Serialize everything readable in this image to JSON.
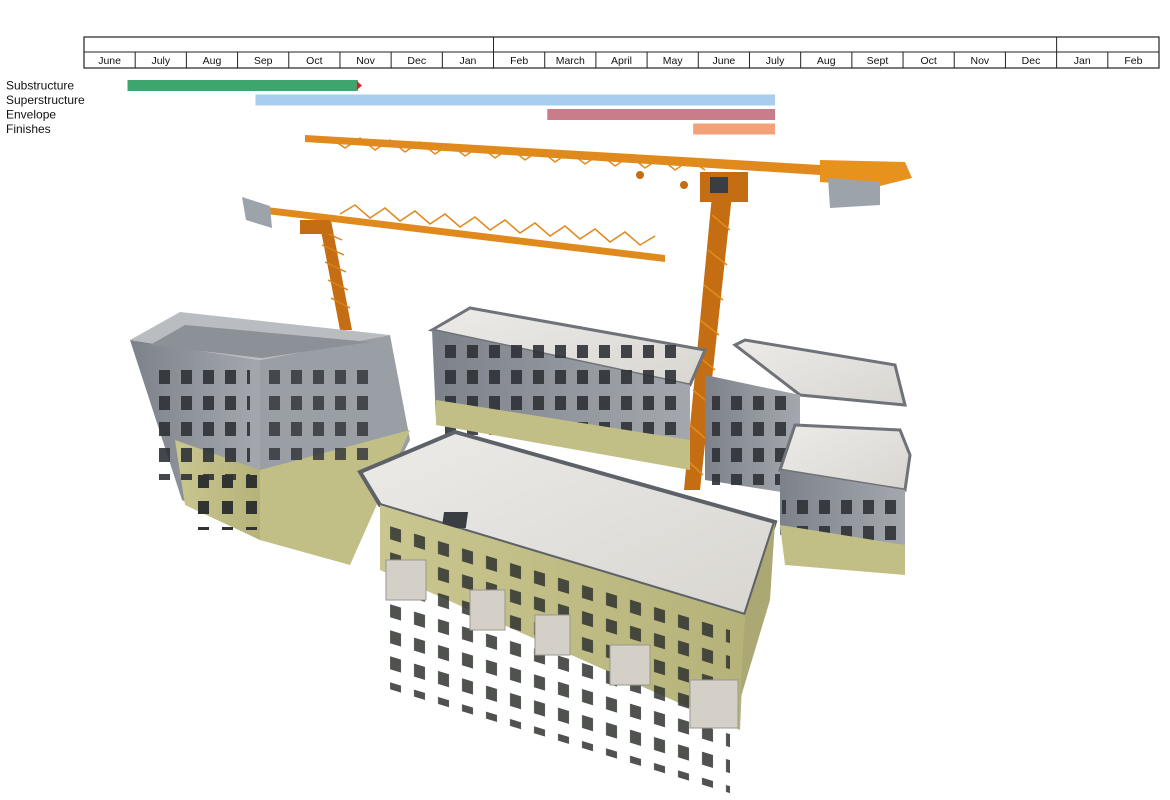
{
  "chart_data": {
    "type": "gantt",
    "title": "",
    "months": [
      "June",
      "July",
      "Aug",
      "Sep",
      "Oct",
      "Nov",
      "Dec",
      "Jan",
      "Feb",
      "March",
      "April",
      "May",
      "June",
      "July",
      "Aug",
      "Sept",
      "Oct",
      "Nov",
      "Dec",
      "Jan",
      "Feb"
    ],
    "year_breaks_before_index": [
      8,
      19
    ],
    "tasks": [
      {
        "name": "Substructure",
        "start": 0.85,
        "end": 5.35,
        "color": "#3ea56e",
        "marker_color": "#e02020"
      },
      {
        "name": "Superstructure",
        "start": 3.35,
        "end": 13.5,
        "color": "#a9cdec"
      },
      {
        "name": "Envelope",
        "start": 9.05,
        "end": 13.5,
        "color": "#c97c8a"
      },
      {
        "name": "Finishes",
        "start": 11.9,
        "end": 13.5,
        "color": "#f2a179"
      }
    ]
  },
  "illustration": {
    "description_icon": "construction-site-icon",
    "crane_color": "#e08a1e",
    "roof_color": "#e6e3df",
    "wall_grey": "#8f949c",
    "wall_green": "#c8c58a"
  }
}
